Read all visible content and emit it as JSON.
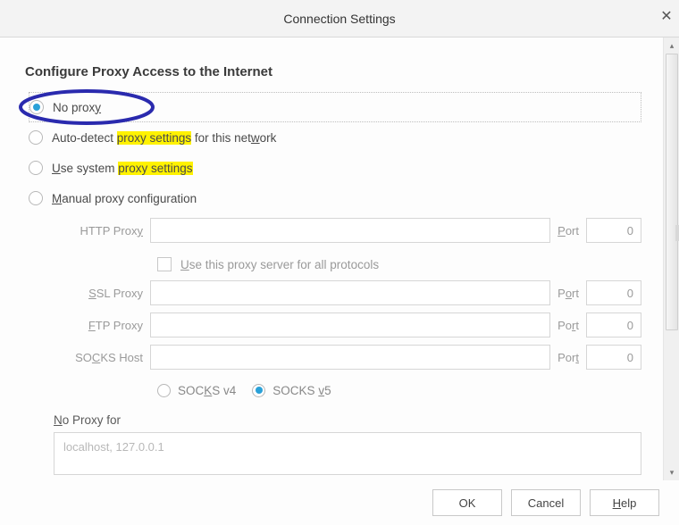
{
  "titlebar": {
    "title": "Connection Settings"
  },
  "heading": "Configure Proxy Access to the Internet",
  "radios": {
    "no_proxy": {
      "parts": [
        "No prox",
        "y"
      ],
      "u_index": 1,
      "highlight_start": -1
    },
    "auto_detect": {
      "pre": "Auto-detect ",
      "hl": "proxy settings",
      "post": " for this net",
      "u": "w",
      "post2": "ork"
    },
    "use_system": {
      "u": "U",
      "pre2": "se system ",
      "hl": "proxy settings"
    },
    "manual": {
      "u": "M",
      "rest": "anual proxy configuration"
    }
  },
  "fields": {
    "http": {
      "label_pre": "HTTP Prox",
      "label_u": "y",
      "port_u": "P",
      "port_rest": "ort",
      "port_value": "0"
    },
    "use_all": {
      "u": "U",
      "rest": "se this proxy server for all protocols"
    },
    "ssl": {
      "label_u": "S",
      "label_rest": "SL Proxy",
      "port_pre": "P",
      "port_u": "o",
      "port_rest": "rt",
      "port_value": "0"
    },
    "ftp": {
      "label_u": "F",
      "label_rest": "TP Proxy",
      "port_pre": "Po",
      "port_u": "r",
      "port_rest": "t",
      "port_value": "0"
    },
    "socks": {
      "label_pre": "SO",
      "label_u": "C",
      "label_rest": "KS Host",
      "port_pre": "Por",
      "port_u": "t",
      "port_rest": "",
      "port_value": "0"
    },
    "socks_v4": {
      "pre": "SOC",
      "u": "K",
      "post": "S v4"
    },
    "socks_v5": {
      "pre": "SOCKS ",
      "u": "v",
      "post": "5"
    }
  },
  "no_proxy_for": {
    "label_u": "N",
    "label_rest": "o Proxy for",
    "value": "localhost, 127.0.0.1"
  },
  "buttons": {
    "ok": "OK",
    "cancel": "Cancel",
    "help_u": "H",
    "help_rest": "elp"
  }
}
